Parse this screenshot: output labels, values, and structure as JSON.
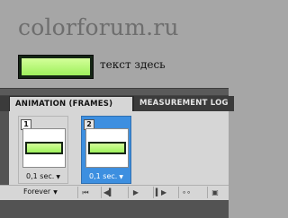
{
  "site": {
    "title": "colorforum.ru"
  },
  "demo": {
    "caption": "текст здесь"
  },
  "panel": {
    "tabs": [
      {
        "label": "ANIMATION (FRAMES)",
        "active": true
      },
      {
        "label": "MEASUREMENT LOG",
        "active": false
      }
    ],
    "frames": [
      {
        "number": "1",
        "delay": "0,1 sec.",
        "selected": false
      },
      {
        "number": "2",
        "delay": "0,1 sec.",
        "selected": true
      }
    ],
    "toolbar": {
      "loop": "Forever",
      "buttons": [
        "first-frame",
        "previous-frame",
        "play",
        "next-frame",
        "tween",
        "new-frame"
      ]
    }
  },
  "colors": {
    "swatch_fill_top": "#d4ff9a",
    "swatch_fill_bottom": "#9ef05c",
    "selected_frame": "#3d8fe0"
  }
}
